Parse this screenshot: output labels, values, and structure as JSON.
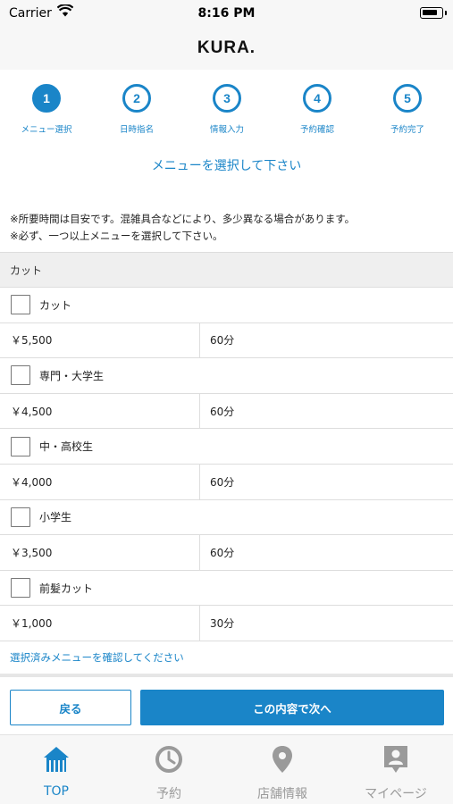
{
  "status_bar": {
    "carrier": "Carrier",
    "time": "8:16 PM"
  },
  "app": {
    "title": "KURA."
  },
  "steps": [
    {
      "number": "1",
      "label": "メニュー選択"
    },
    {
      "number": "2",
      "label": "日時指名"
    },
    {
      "number": "3",
      "label": "情報入力"
    },
    {
      "number": "4",
      "label": "予約確認"
    },
    {
      "number": "5",
      "label": "予約完了"
    }
  ],
  "current_step": 1,
  "heading": "メニューを選択して下さい",
  "notes": [
    "※所要時間は目安です。混雑具合などにより、多少異なる場合があります。",
    "※必ず、一つ以上メニューを選択して下さい。"
  ],
  "category": "カット",
  "menu_items": [
    {
      "name": "カット",
      "price": "￥5,500",
      "duration": "60分"
    },
    {
      "name": "専門・大学生",
      "price": "￥4,500",
      "duration": "60分"
    },
    {
      "name": "中・高校生",
      "price": "￥4,000",
      "duration": "60分"
    },
    {
      "name": "小学生",
      "price": "￥3,500",
      "duration": "60分"
    },
    {
      "name": "前髪カット",
      "price": "￥1,000",
      "duration": "30分"
    }
  ],
  "confirm_link": "選択済みメニューを確認してください",
  "buttons": {
    "back": "戻る",
    "next": "この内容で次へ"
  },
  "tabs": [
    {
      "label": "TOP",
      "icon": "home-icon"
    },
    {
      "label": "予約",
      "icon": "clock-icon"
    },
    {
      "label": "店舗情報",
      "icon": "map-pin-icon"
    },
    {
      "label": "マイページ",
      "icon": "profile-icon"
    }
  ],
  "active_tab": 0,
  "colors": {
    "accent": "#1a85c8",
    "inactive": "#9a9a9a",
    "bar_bg": "#f7f7f7"
  }
}
